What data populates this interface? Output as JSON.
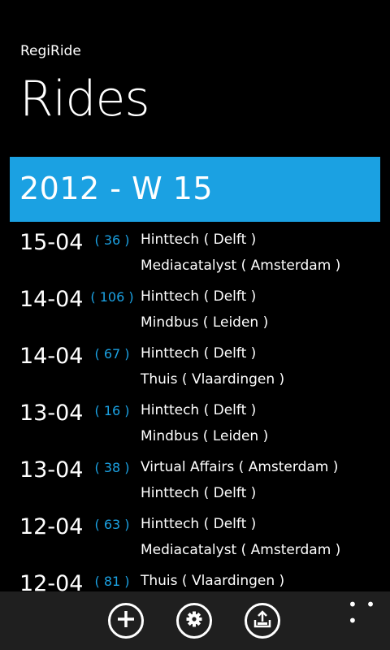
{
  "app": {
    "name": "RegiRide"
  },
  "page": {
    "title": "Rides"
  },
  "week": {
    "label": "2012 - W 15"
  },
  "rides": [
    {
      "date": "15-04",
      "distance": "( 36 )",
      "from": "Hinttech ( Delft )",
      "to": "Mediacatalyst ( Amsterdam )"
    },
    {
      "date": "14-04",
      "distance": "( 106 )",
      "from": "Hinttech ( Delft )",
      "to": "Mindbus ( Leiden )"
    },
    {
      "date": "14-04",
      "distance": "( 67 )",
      "from": "Hinttech ( Delft )",
      "to": "Thuis ( Vlaardingen )"
    },
    {
      "date": "13-04",
      "distance": "( 16 )",
      "from": "Hinttech ( Delft )",
      "to": "Mindbus ( Leiden )"
    },
    {
      "date": "13-04",
      "distance": "( 38 )",
      "from": "Virtual Affairs ( Amsterdam )",
      "to": "Hinttech ( Delft )"
    },
    {
      "date": "12-04",
      "distance": "( 63 )",
      "from": "Hinttech ( Delft )",
      "to": "Mediacatalyst ( Amsterdam )"
    },
    {
      "date": "12-04",
      "distance": "( 81 )",
      "from": "Thuis ( Vlaardingen )",
      "to": ""
    }
  ],
  "appbar": {
    "buttons": [
      {
        "icon": "add-icon"
      },
      {
        "icon": "gear-icon"
      },
      {
        "icon": "upload-icon"
      }
    ],
    "more": "• • •"
  },
  "colors": {
    "accent": "#1ba1e2",
    "background": "#000000",
    "appbar": "#1f1f1f"
  }
}
